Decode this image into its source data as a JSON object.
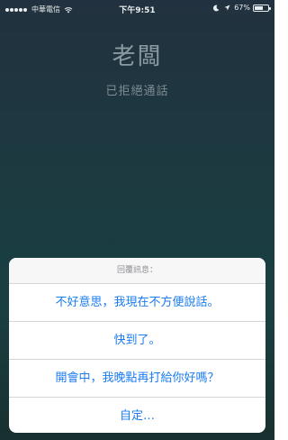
{
  "status_bar": {
    "carrier": "中華電信",
    "time": "下午9:51",
    "battery_percent": "67%",
    "battery_level": 0.67,
    "icons": [
      "signal-dots-icon",
      "wifi-icon",
      "moon-icon",
      "location-arrow-icon",
      "battery-icon"
    ]
  },
  "call": {
    "caller_name": "老闆",
    "status": "已拒絕通話"
  },
  "action_sheet": {
    "title": "回覆訊息：",
    "options": [
      "不好意思，我現在不方便說話。",
      "快到了。",
      "開會中，我晚點再打給你好嗎？",
      "自定…"
    ]
  },
  "colors": {
    "accent": "#1a7cf0",
    "background": "#1b3b40"
  }
}
